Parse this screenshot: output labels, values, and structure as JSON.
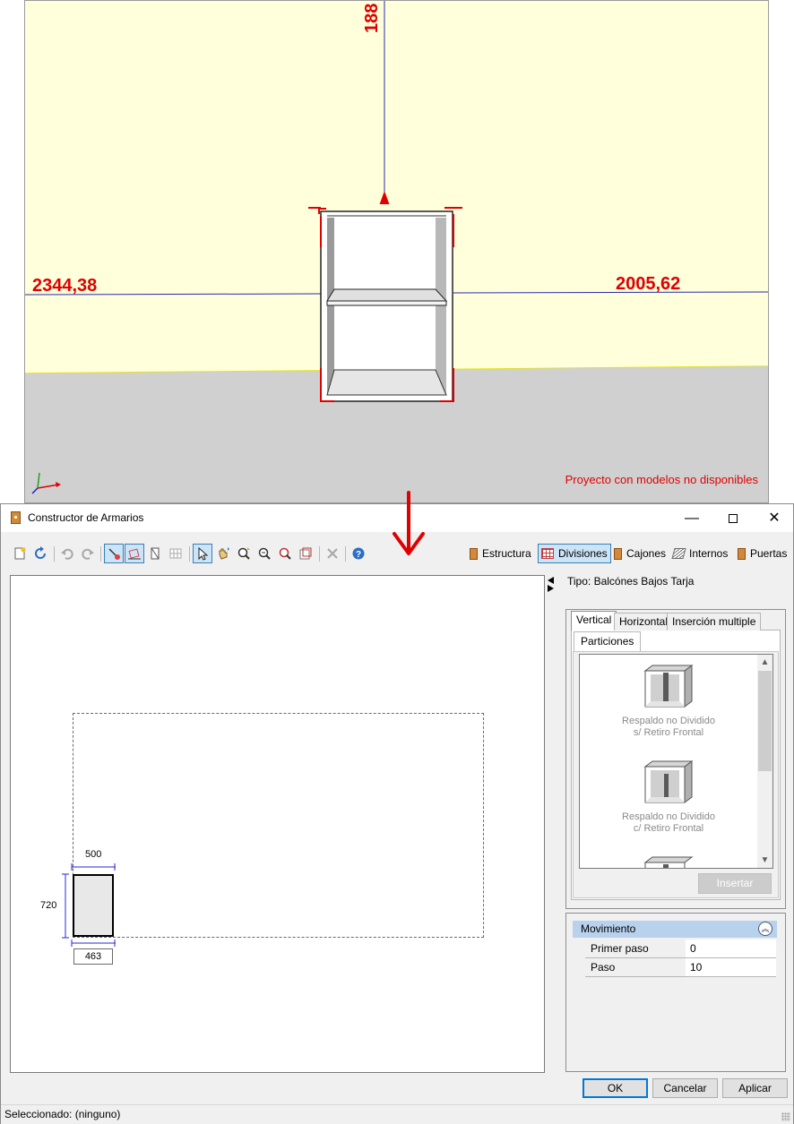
{
  "viewport": {
    "dimension_left": "2344,38",
    "dimension_right": "2005,62",
    "dimension_top": "188",
    "warning": "Proyecto con modelos no disponibles"
  },
  "window": {
    "title": "Constructor de Armarios",
    "minimize": "—",
    "close": "✕"
  },
  "toolbar": {
    "tabs": [
      "Estructura",
      "Divisiones",
      "Cajones",
      "Internos",
      "Puertas"
    ],
    "active_tab": "Divisiones"
  },
  "plan": {
    "width_label": "500",
    "height_label": "720",
    "depth_label": "463"
  },
  "panel": {
    "tipo": "Tipo: Balcónes Bajos Tarja",
    "tabs": [
      "Vertical",
      "Horizontal",
      "Inserción multiple"
    ],
    "active_tab": "Vertical",
    "subtab": "Particiones",
    "gallery": [
      {
        "line1": "Respaldo no Dividido",
        "line2": "s/ Retiro Frontal"
      },
      {
        "line1": "Respaldo no Dividido",
        "line2": "c/ Retiro Frontal"
      }
    ],
    "insert_button": "Insertar"
  },
  "props": {
    "header": "Movimiento",
    "rows": [
      {
        "label": "Primer paso",
        "value": "0"
      },
      {
        "label": "Paso",
        "value": "10"
      }
    ]
  },
  "buttons": {
    "ok": "OK",
    "cancel": "Cancelar",
    "apply": "Aplicar"
  },
  "status": "Seleccionado: (ninguno)",
  "colors": {
    "dimension_red": "#e00000",
    "wall": "#ffffdc",
    "floor": "#d0d0d0",
    "accent_blue": "#0078d7"
  }
}
